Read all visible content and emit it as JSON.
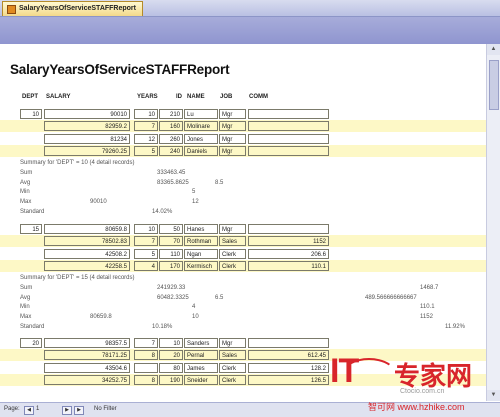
{
  "tab": {
    "label": "SalaryYearsOfServiceSTAFFReport"
  },
  "report_title": "SalaryYearsOfServiceSTAFFReport",
  "columns": [
    "DEPT",
    "SALARY",
    "YEARS",
    "ID",
    "NAME",
    "JOB",
    "COMM"
  ],
  "groups": [
    {
      "dept": "10",
      "rows": [
        {
          "salary": "90010",
          "years": "10",
          "id": "210",
          "name": "Lu",
          "job": "Mgr",
          "comm": ""
        },
        {
          "salary": "82959.2",
          "years": "7",
          "id": "160",
          "name": "Molinare",
          "job": "Mgr",
          "comm": ""
        },
        {
          "salary": "81234",
          "years": "12",
          "id": "260",
          "name": "Jones",
          "job": "Mgr",
          "comm": ""
        },
        {
          "salary": "79260.25",
          "years": "5",
          "id": "240",
          "name": "Daniels",
          "job": "Mgr",
          "comm": ""
        }
      ],
      "summary_title": "Summary for 'DEPT' = 10 (4 detail records)",
      "sum": {
        "label": "Sum",
        "salary": "333463.45",
        "years": "",
        "comm": ""
      },
      "avg": {
        "label": "Avg",
        "salary": "83365.8625",
        "years": "8.5",
        "comm": ""
      },
      "min": {
        "label": "Min",
        "salary": "",
        "years": "5",
        "comm": ""
      },
      "max": {
        "label": "Max",
        "salary": "90010",
        "years": "12",
        "comm": ""
      },
      "standard": {
        "label": "Standard",
        "salary": "14.02%",
        "comm": ""
      }
    },
    {
      "dept": "15",
      "rows": [
        {
          "salary": "80659.8",
          "years": "10",
          "id": "50",
          "name": "Hanes",
          "job": "Mgr",
          "comm": ""
        },
        {
          "salary": "78502.83",
          "years": "7",
          "id": "70",
          "name": "Rothman",
          "job": "Sales",
          "comm": "1152"
        },
        {
          "salary": "42508.2",
          "years": "5",
          "id": "110",
          "name": "Ngan",
          "job": "Clerk",
          "comm": "206.6"
        },
        {
          "salary": "42258.5",
          "years": "4",
          "id": "170",
          "name": "Kermisch",
          "job": "Clerk",
          "comm": "110.1"
        }
      ],
      "summary_title": "Summary for 'DEPT' = 15 (4 detail records)",
      "sum": {
        "label": "Sum",
        "salary": "241929.33",
        "years": "",
        "comm": "1468.7"
      },
      "avg": {
        "label": "Avg",
        "salary": "60482.3325",
        "years": "6.5",
        "comm": "489.566666666667"
      },
      "min": {
        "label": "Min",
        "salary": "",
        "years": "4",
        "comm": "110.1"
      },
      "max": {
        "label": "Max",
        "salary": "80659.8",
        "years": "10",
        "comm": "1152"
      },
      "standard": {
        "label": "Standard",
        "salary": "10.18%",
        "comm": "11.92%"
      }
    },
    {
      "dept": "20",
      "rows": [
        {
          "salary": "98357.5",
          "years": "7",
          "id": "10",
          "name": "Sanders",
          "job": "Mgr",
          "comm": ""
        },
        {
          "salary": "78171.25",
          "years": "8",
          "id": "20",
          "name": "Pernal",
          "job": "Sales",
          "comm": "612.45"
        },
        {
          "salary": "43504.6",
          "years": "",
          "id": "80",
          "name": "James",
          "job": "Clerk",
          "comm": "128.2"
        },
        {
          "salary": "34252.75",
          "years": "8",
          "id": "190",
          "name": "Sneider",
          "job": "Clerk",
          "comm": "126.5"
        }
      ]
    }
  ],
  "footer": {
    "page_label": "Page:",
    "page_number": "1",
    "filter_label": "No Filter"
  },
  "watermark": {
    "it": "IT",
    "cn": "专家网",
    "url": "Ctocio.com.cn",
    "bottom": "智可网 www.hzhike.com"
  },
  "colors": {
    "row_highlight": "#fdf8c6",
    "header_band": "#9ea3d6",
    "brand_red": "#d8252b"
  }
}
